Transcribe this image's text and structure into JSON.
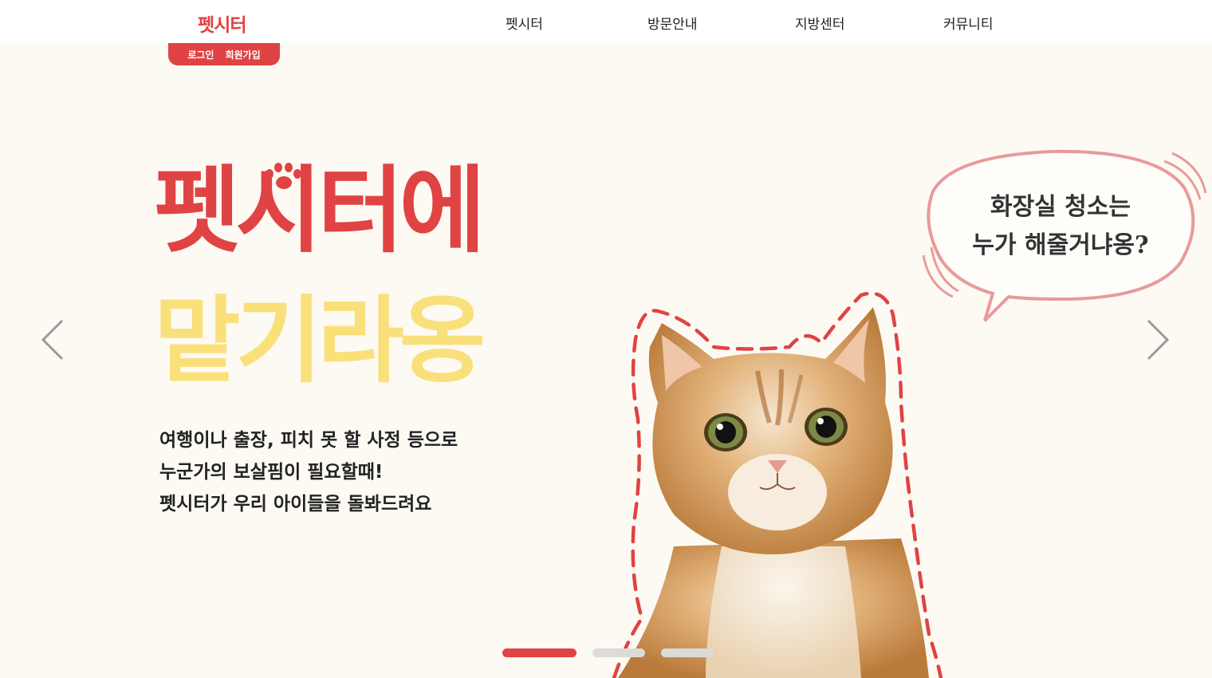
{
  "header": {
    "logo": "펫시터",
    "nav": [
      "펫시터",
      "방문안내",
      "지방센터",
      "커뮤니티"
    ],
    "login": "로그인",
    "signup": "회원가입"
  },
  "hero": {
    "headline_line1": "펫시터에",
    "headline_line2": "맡기라옹",
    "description": [
      "여행이나 출장, 피치 못 할 사정 등으로",
      "누군가의 보살핌이 필요할때!",
      "펫시터가 우리 아이들을 돌봐드려요"
    ],
    "speech_bubble": [
      "화장실 청소는",
      "누가 해줄거냐옹?"
    ]
  },
  "carousel": {
    "slides": 3,
    "active_index": 0
  },
  "colors": {
    "brand_red": "#e04343",
    "accent_yellow": "#fae07a",
    "background": "#fdfaf3",
    "bubble_stroke": "#e89a9a"
  },
  "icons": {
    "prev": "chevron-left-icon",
    "next": "chevron-right-icon",
    "paw": "paw-icon"
  }
}
